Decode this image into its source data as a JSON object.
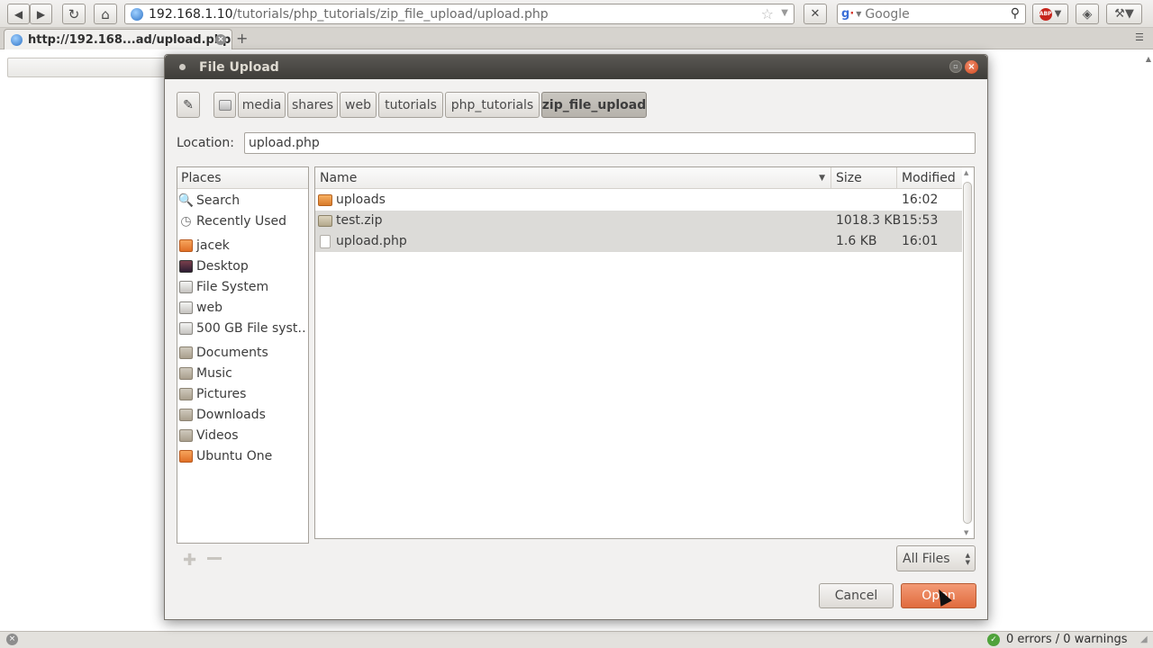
{
  "browser": {
    "url_prefix": "192.168.1.10",
    "url_path": "/tutorials/php_tutorials/zip_file_upload/upload.php",
    "search_placeholder": "Google",
    "tab_title": "http://192.168...ad/upload.php",
    "status_text": "0 errors / 0 warnings"
  },
  "dialog": {
    "title": "File Upload",
    "location_label": "Location:",
    "location_value": "upload.php",
    "breadcrumbs": [
      "media",
      "shares",
      "web",
      "tutorials",
      "php_tutorials",
      "zip_file_upload"
    ],
    "places": {
      "header": "Places",
      "items": [
        {
          "label": "Search",
          "icon": "search-icon"
        },
        {
          "label": "Recently Used",
          "icon": "recent-icon"
        },
        {
          "label": "jacek",
          "icon": "home-folder-icon"
        },
        {
          "label": "Desktop",
          "icon": "desktop-icon"
        },
        {
          "label": "File System",
          "icon": "drive-icon"
        },
        {
          "label": "web",
          "icon": "drive-icon"
        },
        {
          "label": "500 GB File syst…",
          "icon": "drive-icon"
        },
        {
          "label": "Documents",
          "icon": "folder-icon"
        },
        {
          "label": "Music",
          "icon": "folder-icon"
        },
        {
          "label": "Pictures",
          "icon": "folder-icon"
        },
        {
          "label": "Downloads",
          "icon": "folder-icon"
        },
        {
          "label": "Videos",
          "icon": "folder-icon"
        },
        {
          "label": "Ubuntu One",
          "icon": "folder-icon"
        }
      ]
    },
    "files": {
      "columns": [
        "Name",
        "Size",
        "Modified"
      ],
      "rows": [
        {
          "name": "uploads",
          "size": "",
          "modified": "16:02",
          "icon": "folder-icon"
        },
        {
          "name": "test.zip",
          "size": "1018.3 KB",
          "modified": "15:53",
          "icon": "zip-icon"
        },
        {
          "name": "upload.php",
          "size": "1.6 KB",
          "modified": "16:01",
          "icon": "document-icon"
        }
      ]
    },
    "filter": "All Files",
    "cancel_label": "Cancel",
    "open_label": "Open"
  }
}
